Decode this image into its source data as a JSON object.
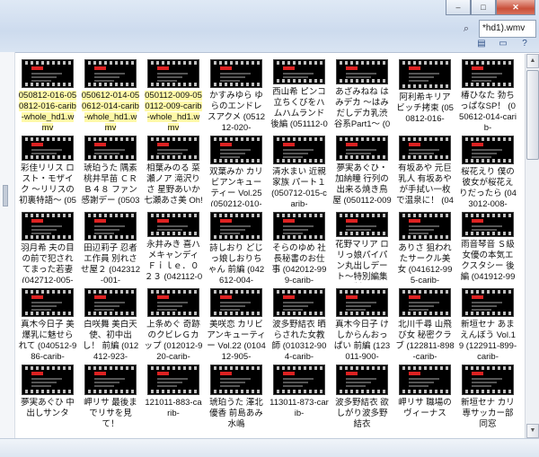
{
  "window": {
    "minimize": "–",
    "maximize": "□",
    "close": "✕"
  },
  "search": {
    "value": "*hd1).wmv"
  },
  "toolbar": {
    "icons": [
      "view-icon",
      "layout-pane-icon",
      "help-icon"
    ]
  },
  "files": [
    "050812-016-050812-016-carib-whole_hd1.wmv",
    "050612-014-050612-014-carib-whole_hd1.wmv",
    "050112-009-050112-009-carib-whole_hd1.wmv",
    "かすみゆら ゆらのエンドレスアクメ (051212-020-",
    "西山希 ピンコ立ちくびをハムハムランド 後編 (051112-019-",
    "あざみねね はみデカ ～はみだしデカ乳渋谷系Part1～ (0510",
    "阿利希キリアビッチ拷束 (050812-016-",
    "椿ひなた 勃ちっぱなSP！ (050612-014-carib-",
    "彩佳リリス ロスト・モザイク ～リリスの初裏特語～ (050512-",
    "琥珀うた 隅素 桃井早苗 ＣＲＢ４８ ファン感謝デー (050312-",
    "相葉みのる 菜瀬ノア 滝沢りさ 星野あいか 七瀬あさ美 Oh! Sum",
    "双葉みか カリビアンキューティー Vol.25 (050212-010-",
    "清水まい 近親家族 パート１ (050712-015-carib-",
    "夢実あぐひ・加納瞳 行列の出来る焼き鳥屋 (050112-009-",
    "有坂あや 元巨乳人 有坂あやが手拭い一枚で温泉に！ (042912-",
    "桜花えり 僕の彼女が桜花えりだったら (043012-008-",
    "羽月希 夫の目の前で犯されてまった若妻 (042712-005-",
    "田辺莉子 忍者エ作員 別れさせ屋２ (042312-001-",
    "永井みき 喜ハメキャンディ Ｆｉｌｅ．０２３ (042112-000-",
    "詩しおり どじっ娘しおりちゃん 前編 (042612-004-",
    "そらのゆめ 社長秘書のお仕事 (042012-999-carib-",
    "花野マリア ロリっ娘パイパン丸出しデート～特別編集版～",
    "ありさ 狙われたサークル美女 (041612-995-carib-",
    "雨音琴音 Ｓ級女優の本気エクスタシー 後編 (041912-998-",
    "真木今日子 美爆乳に魅せられて (040512-986-carib-",
    "白咲舞 美白天使、初中出し！ 前編 (012412-923-",
    "上条めぐ 奇跡のクビレＧカップ (012012-920-carib-",
    "美咲恋 カリビアンキューティー Vol.22 (010412-905-",
    "波多野結衣 晒らされた女教師 (010312-904-carib-",
    "真木今日子 けしからんおっぱい 前編 (123011-900-",
    "北川千尋 山飛び女 秘密クラブ (122811-898-carib-",
    "新垣セナ あまえんぼう Vol.19 (122911-899-carib-",
    "夢実あぐひ 中出しサンタ",
    "岬リサ 最後までリサを見て！",
    "121011-883-carib-",
    "琥珀うた 澤北優香 前島あみ 水嶋",
    "113011-873-carib-",
    "波多野結衣 欲しがり波多野結衣",
    "岬リサ 職場のヴィーナス",
    "新垣セナ カリ専サッカー部同窓"
  ]
}
